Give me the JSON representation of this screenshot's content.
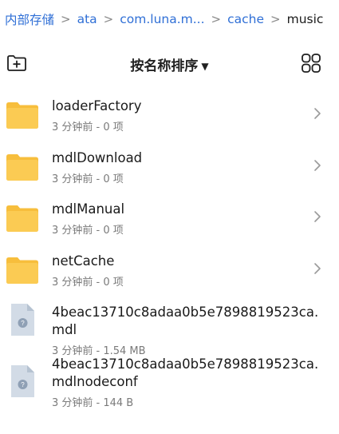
{
  "breadcrumb": [
    "内部存储",
    "ata",
    "com.luna.m...",
    "cache",
    "music"
  ],
  "toolbar": {
    "sort_label": "按名称排序",
    "sort_caret": "▼",
    "new_folder_icon": "new-folder-icon",
    "view_toggle_icon": "grid-view-icon"
  },
  "colors": {
    "accent": "#2f6fd6",
    "folder": "#f7be3c",
    "file": "#cfd8e3"
  },
  "items": [
    {
      "name": "loaderFactory",
      "meta": "3 分钟前 - 0 项",
      "type": "folder"
    },
    {
      "name": "mdlDownload",
      "meta": "3 分钟前 - 0 项",
      "type": "folder"
    },
    {
      "name": "mdlManual",
      "meta": "3 分钟前 - 0 项",
      "type": "folder"
    },
    {
      "name": "netCache",
      "meta": "3 分钟前 - 0 项",
      "type": "folder"
    },
    {
      "name": "4beac13710c8adaa0b5e7898819523ca.mdl",
      "meta": "3 分钟前 - 1.54 MB",
      "type": "file"
    },
    {
      "name": "4beac13710c8adaa0b5e7898819523ca.mdlnodeconf",
      "meta": "3 分钟前 - 144 B",
      "type": "file"
    }
  ]
}
